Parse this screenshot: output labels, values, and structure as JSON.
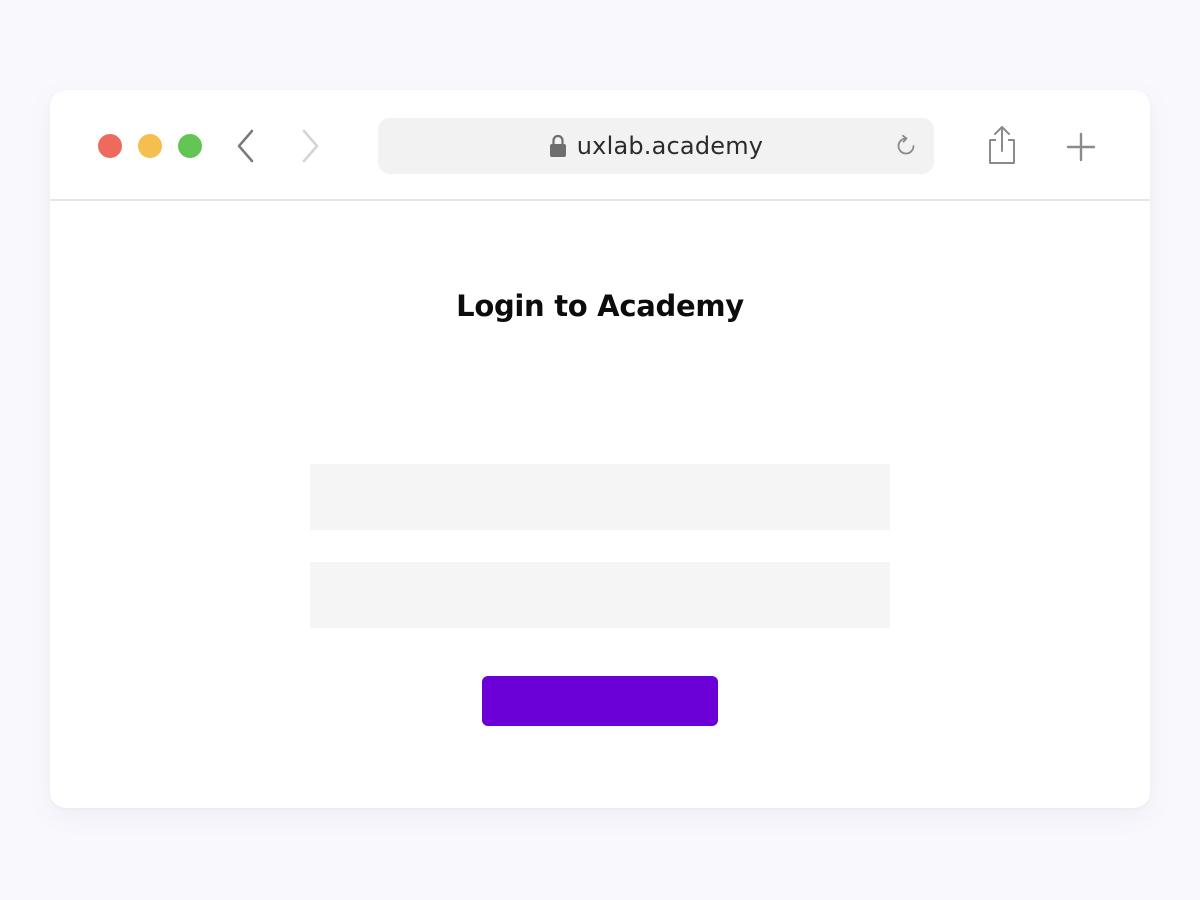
{
  "browser": {
    "url": "uxlab.academy",
    "traffic_lights": {
      "close": "#ee6a5f",
      "minimize": "#f5be4f",
      "maximize": "#62c554"
    },
    "icons": {
      "back": "chevron-left-icon",
      "forward": "chevron-right-icon",
      "lock": "lock-icon",
      "reload": "reload-icon",
      "share": "share-icon",
      "new_tab": "plus-icon"
    }
  },
  "page": {
    "title": "Login to Academy",
    "fields": [
      {
        "value": "",
        "placeholder": ""
      },
      {
        "value": "",
        "placeholder": ""
      }
    ],
    "submit": {
      "label": "",
      "color": "#6b00d7"
    }
  },
  "colors": {
    "background": "#f9f8fd",
    "field_bg": "#f5f5f5",
    "accent": "#6b00d7"
  }
}
